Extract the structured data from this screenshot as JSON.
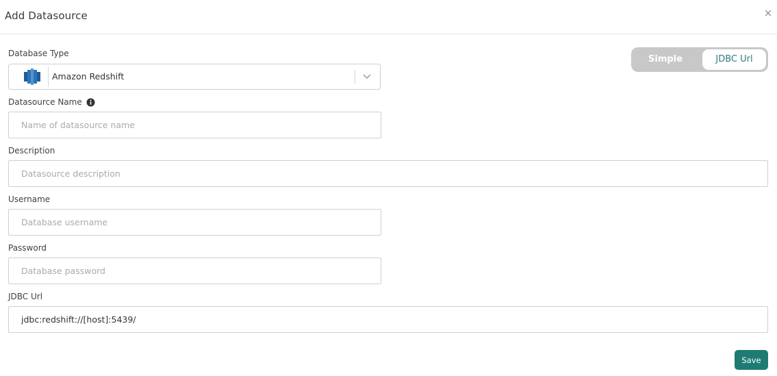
{
  "header": {
    "title": "Add Datasource",
    "close_label": "×"
  },
  "mode_toggle": {
    "options": [
      "Simple",
      "JDBC Url"
    ],
    "selected": "JDBC Url"
  },
  "form": {
    "database_type": {
      "label": "Database Type",
      "value": "Amazon Redshift",
      "icon": "amazon-redshift-icon"
    },
    "datasource_name": {
      "label": "Datasource Name",
      "placeholder": "Name of datasource name",
      "value": ""
    },
    "description": {
      "label": "Description",
      "placeholder": "Datasource description",
      "value": ""
    },
    "username": {
      "label": "Username",
      "placeholder": "Database username",
      "value": ""
    },
    "password": {
      "label": "Password",
      "placeholder": "Database password",
      "value": ""
    },
    "jdbc_url": {
      "label": "JDBC Url",
      "placeholder": "",
      "value": "jdbc:redshift://[host]:5439/"
    }
  },
  "footer": {
    "save_label": "Save"
  },
  "colors": {
    "accent": "#1e7b73",
    "toggle_bg": "#c8c8c8",
    "toggle_active_text": "#2e7d7d",
    "border": "#cfcfcf"
  }
}
